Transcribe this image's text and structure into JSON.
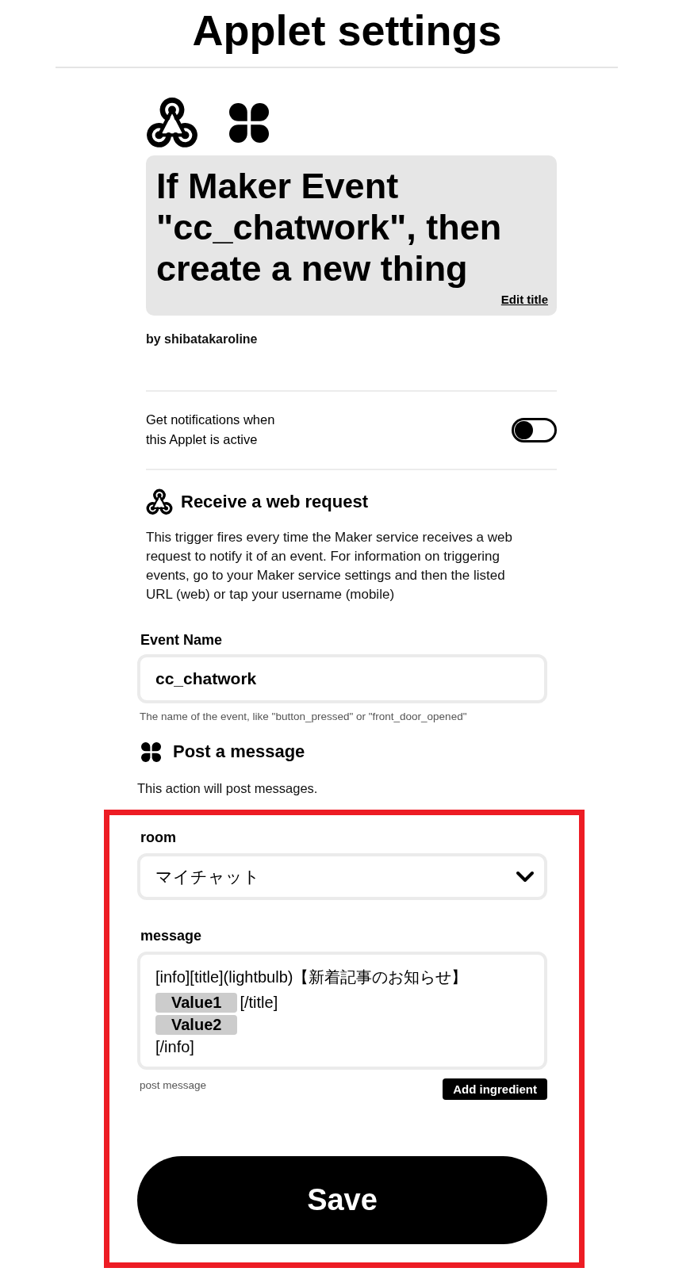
{
  "header": {
    "title": "Applet settings"
  },
  "applet": {
    "title": "If Maker Event \"cc_chatwork\", then create a new thing",
    "edit_link": "Edit title",
    "author": "by shibatakaroline"
  },
  "notifications": {
    "label": "Get notifications when this Applet is active",
    "on": false
  },
  "trigger": {
    "name": "Receive a web request",
    "description": "This trigger fires every time the Maker service receives a web request to notify it of an event. For information on triggering events, go to your Maker service settings and then the listed URL (web) or tap your username (mobile)",
    "fields": [
      {
        "kind": "text",
        "label": "Event Name",
        "value": "cc_chatwork",
        "hint": "The name of the event, like \"button_pressed\" or \"front_door_opened\""
      }
    ]
  },
  "action": {
    "name": "Post a message",
    "description": "This action will post messages.",
    "fields": [
      {
        "kind": "select",
        "label": "room",
        "value": "マイチャット"
      },
      {
        "kind": "message",
        "label": "message",
        "lines": [
          [
            {
              "kind": "text",
              "text": "[info][title](lightbulb)【新着記事のお知らせ】"
            }
          ],
          [
            {
              "kind": "ingredient",
              "text": "Value1"
            },
            {
              "kind": "text",
              "text": "[/title]"
            }
          ],
          [
            {
              "kind": "ingredient",
              "text": "Value2"
            }
          ],
          [
            {
              "kind": "text",
              "text": "[/info]"
            }
          ]
        ],
        "hint": "post message",
        "button": "Add ingredient"
      }
    ]
  },
  "save_button": {
    "label": "Save"
  }
}
